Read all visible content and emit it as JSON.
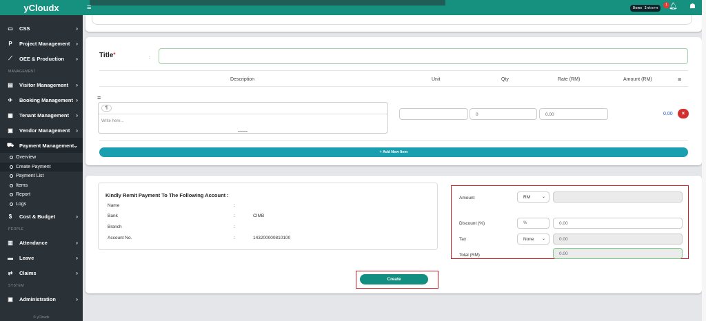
{
  "app": {
    "brand": "yCloudx",
    "footer": "© yCloudx"
  },
  "topbar": {
    "env_badge": "Demo Intern",
    "notification_count": "1"
  },
  "sidebar": {
    "items_top": [
      {
        "label": "CSS",
        "icon": "monitor-icon"
      },
      {
        "label": "Project Management",
        "icon": "p-icon"
      },
      {
        "label": "OEE & Production",
        "icon": "chart-icon"
      }
    ],
    "section_management": "MANAGEMENT",
    "items_management": [
      {
        "label": "Visitor Management",
        "icon": "id-card-icon"
      },
      {
        "label": "Booking Management",
        "icon": "plane-icon"
      },
      {
        "label": "Tenant Management",
        "icon": "building-icon"
      },
      {
        "label": "Vendor Management",
        "icon": "vendor-icon"
      },
      {
        "label": "Payment Management",
        "icon": "cart-icon"
      }
    ],
    "payment_sub": [
      "Overview",
      "Create Payment",
      "Payment List",
      "Items",
      "Report",
      "Logs"
    ],
    "cost_budget": "Cost & Budget",
    "section_people": "PEOPLE",
    "items_people": [
      {
        "label": "Attendance",
        "icon": "calendar-icon"
      },
      {
        "label": "Leave",
        "icon": "briefcase-icon"
      },
      {
        "label": "Claims",
        "icon": "exchange-icon"
      }
    ],
    "section_system": "SYSTEM",
    "administration": "Administration"
  },
  "form": {
    "title_label": "Title",
    "required_mark": "*",
    "title_colon": ":",
    "title_value": "",
    "items_header": {
      "description": "Description",
      "unit": "Unit",
      "qty": "Qty",
      "rate": "Rate (RM)",
      "amount": "Amount (RM)"
    },
    "row": {
      "editor_placeholder": "Write here...",
      "paragraph_glyph": "¶",
      "unit_value": "",
      "qty_value": "0",
      "rate_value": "0.00",
      "amount": "0.00"
    },
    "add_item_label": "+ Add New Item"
  },
  "bank": {
    "heading": "Kindly Remit Payment To The Following Account :",
    "rows": [
      {
        "label": "Name",
        "value": ""
      },
      {
        "label": "Bank",
        "value": "CIMB"
      },
      {
        "label": "Branch",
        "value": ""
      },
      {
        "label": "Account No.",
        "value": "143200000810100"
      }
    ],
    "colon": ":"
  },
  "totals": {
    "amount_label": "Amount",
    "currency": "RM",
    "amount_value": "",
    "discount_label": "Discount (%)",
    "discount_unit": "%",
    "discount_value": "0.00",
    "tax_label": "Tax",
    "tax_option": "None",
    "tax_value": "0.00",
    "total_label": "Total (RM)",
    "total_value": "0.00"
  },
  "actions": {
    "create_label": "Create"
  },
  "colors": {
    "brand_teal": "#16907f",
    "sidebar_bg": "#2a3238",
    "add_btn": "#1a9fb0",
    "highlight_red": "#d01f25"
  }
}
